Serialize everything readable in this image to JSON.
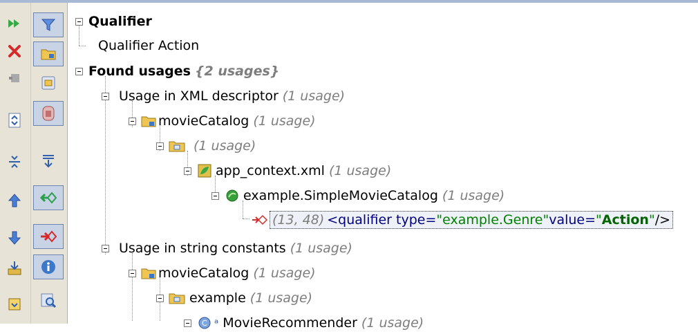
{
  "window": {
    "top_border_color": "#a7b9d5"
  },
  "left_toolbar": {
    "buttons": [
      {
        "icon": "rerun-icon"
      },
      {
        "icon": "close-icon"
      },
      {
        "icon": "pin-tab-icon"
      },
      {
        "icon": "expand-all-icon"
      },
      {
        "icon": "collapse-all-icon"
      },
      {
        "icon": "previous-occurrence-icon"
      },
      {
        "icon": "next-occurrence-icon"
      },
      {
        "icon": "export-icon"
      },
      {
        "icon": "help-icon"
      }
    ]
  },
  "filter_toolbar": {
    "buttons": [
      {
        "icon": "filter-icon",
        "pressed": true
      },
      {
        "icon": "group-by-module-icon",
        "pressed": true
      },
      {
        "icon": "group-by-package-icon",
        "pressed": false
      },
      {
        "icon": "group-by-file-structure-icon",
        "pressed": true
      },
      {
        "icon": "autoscroll-to-source-icon",
        "pressed": false
      },
      {
        "icon": "show-read-access-icon",
        "pressed": true
      },
      {
        "icon": "show-write-access-icon",
        "pressed": true
      },
      {
        "icon": "info-icon",
        "pressed": true
      },
      {
        "icon": "preview-usages-icon",
        "pressed": false
      }
    ]
  },
  "tree": {
    "qualifier": {
      "label": "Qualifier",
      "action": "Qualifier Action"
    },
    "found_usages": {
      "label": "Found usages",
      "count": "{2 usages}"
    },
    "xml_group": {
      "label": "Usage in XML descriptor",
      "count": "(1 usage)"
    },
    "xml_module": {
      "label": "movieCatalog",
      "count": "(1 usage)"
    },
    "xml_package": {
      "label": "",
      "count": "(1 usage)"
    },
    "xml_file": {
      "label": "app_context.xml",
      "count": "(1 usage)"
    },
    "xml_bean": {
      "label": "example.SimpleMovieCatalog",
      "count": "(1 usage)"
    },
    "xml_usage": {
      "coords": "(13, 48)",
      "tag_open": "<qualifier type=",
      "type_value": "\"example.Genre\"",
      "value_attr": " value=",
      "quote_open": "\"",
      "value_bold": "Action",
      "quote_close": "\"",
      "tag_close": "/>"
    },
    "string_group": {
      "label": "Usage in string constants",
      "count": "(1 usage)"
    },
    "string_module": {
      "label": "movieCatalog",
      "count": "(1 usage)"
    },
    "string_package": {
      "label": "example",
      "count": "(1 usage)"
    },
    "string_class": {
      "label": "MovieRecommender",
      "count": "(1 usage)"
    }
  }
}
